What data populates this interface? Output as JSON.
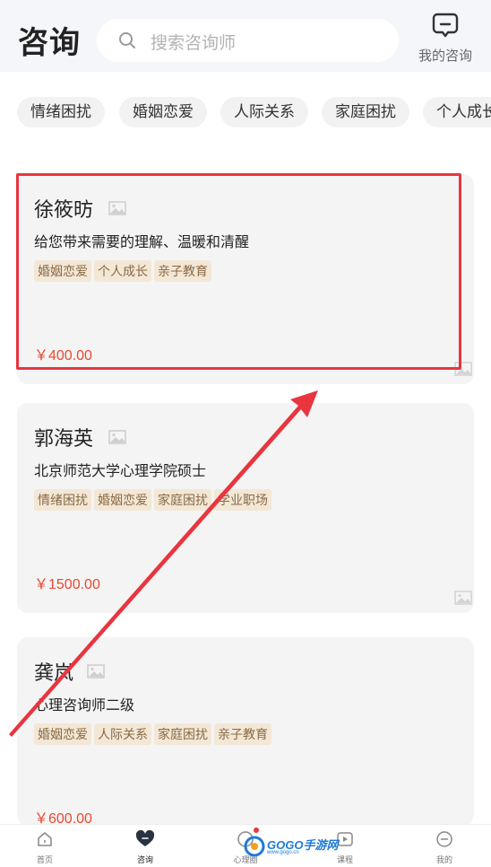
{
  "header": {
    "title": "咨询",
    "search_placeholder": "搜索咨询师",
    "my_consult_label": "我的咨询",
    "my_consult_icon": "chat-bubble-icon"
  },
  "filters": [
    "情绪困扰",
    "婚姻恋爱",
    "人际关系",
    "家庭困扰",
    "个人成长"
  ],
  "counselors": [
    {
      "name": "徐筱昉",
      "desc": "给您带来需要的理解、温暖和清醒",
      "tags": [
        "婚姻恋爱",
        "个人成长",
        "亲子教育"
      ],
      "price": "￥400.00"
    },
    {
      "name": "郭海英",
      "desc": "北京师范大学心理学院硕士",
      "tags": [
        "情绪困扰",
        "婚姻恋爱",
        "家庭困扰",
        "学业职场"
      ],
      "price": "￥1500.00"
    },
    {
      "name": "龚岚",
      "desc": "心理咨询师二级",
      "tags": [
        "婚姻恋爱",
        "人际关系",
        "家庭困扰",
        "亲子教育"
      ],
      "price": "￥600.00"
    }
  ],
  "tabbar": {
    "items": [
      {
        "label": "首页",
        "icon": "home-icon"
      },
      {
        "label": "咨询",
        "icon": "heart-icon"
      },
      {
        "label": "心理圈",
        "icon": "circle-icon"
      },
      {
        "label": "课程",
        "icon": "play-icon"
      },
      {
        "label": "我的",
        "icon": "profile-icon"
      }
    ]
  },
  "watermark": {
    "text": "GOGO手游网",
    "sub": "www.gogo.cn"
  },
  "colors": {
    "accent_red": "#e8353e",
    "price": "#e8492f",
    "tag_bg": "#f3e7d6",
    "tag_text": "#8a6a45"
  }
}
